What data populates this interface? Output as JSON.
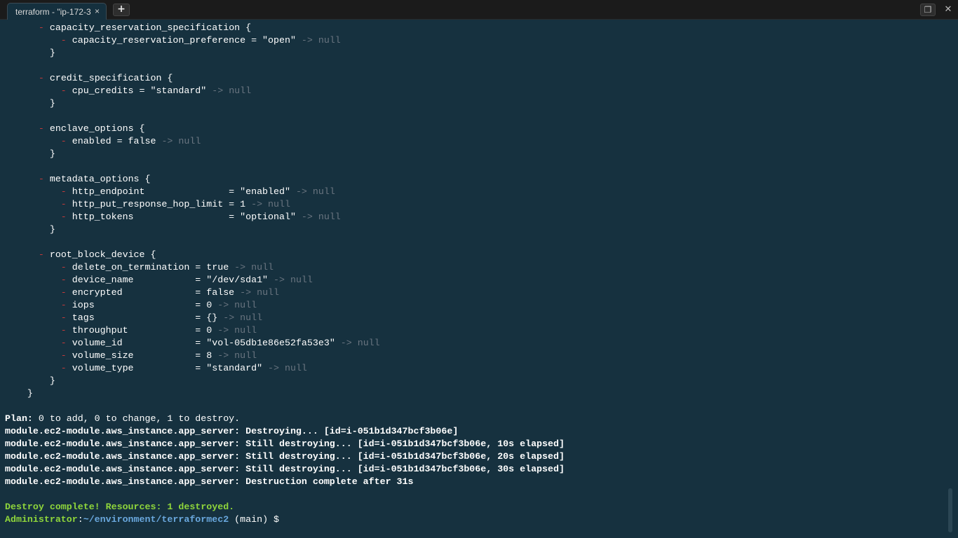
{
  "tab": {
    "title": "terraform - \"ip-172-3",
    "close_glyph": "×"
  },
  "new_tab_glyph": "+",
  "window": {
    "restore_glyph": "❐",
    "close_glyph": "✕"
  },
  "terminal": {
    "lines": [
      {
        "segs": [
          {
            "t": "      "
          },
          {
            "t": "-",
            "c": "minus"
          },
          {
            "t": " capacity_reservation_specification {"
          }
        ]
      },
      {
        "segs": [
          {
            "t": "          "
          },
          {
            "t": "-",
            "c": "minus"
          },
          {
            "t": " capacity_reservation_preference = \"open\" "
          },
          {
            "t": "-> null",
            "c": "null"
          }
        ]
      },
      {
        "segs": [
          {
            "t": "        }"
          }
        ]
      },
      {
        "segs": []
      },
      {
        "segs": [
          {
            "t": "      "
          },
          {
            "t": "-",
            "c": "minus"
          },
          {
            "t": " credit_specification {"
          }
        ]
      },
      {
        "segs": [
          {
            "t": "          "
          },
          {
            "t": "-",
            "c": "minus"
          },
          {
            "t": " cpu_credits = \"standard\" "
          },
          {
            "t": "-> null",
            "c": "null"
          }
        ]
      },
      {
        "segs": [
          {
            "t": "        }"
          }
        ]
      },
      {
        "segs": []
      },
      {
        "segs": [
          {
            "t": "      "
          },
          {
            "t": "-",
            "c": "minus"
          },
          {
            "t": " enclave_options {"
          }
        ]
      },
      {
        "segs": [
          {
            "t": "          "
          },
          {
            "t": "-",
            "c": "minus"
          },
          {
            "t": " enabled = false "
          },
          {
            "t": "-> null",
            "c": "null"
          }
        ]
      },
      {
        "segs": [
          {
            "t": "        }"
          }
        ]
      },
      {
        "segs": []
      },
      {
        "segs": [
          {
            "t": "      "
          },
          {
            "t": "-",
            "c": "minus"
          },
          {
            "t": " metadata_options {"
          }
        ]
      },
      {
        "segs": [
          {
            "t": "          "
          },
          {
            "t": "-",
            "c": "minus"
          },
          {
            "t": " http_endpoint               = \"enabled\" "
          },
          {
            "t": "-> null",
            "c": "null"
          }
        ]
      },
      {
        "segs": [
          {
            "t": "          "
          },
          {
            "t": "-",
            "c": "minus"
          },
          {
            "t": " http_put_response_hop_limit = 1 "
          },
          {
            "t": "-> null",
            "c": "null"
          }
        ]
      },
      {
        "segs": [
          {
            "t": "          "
          },
          {
            "t": "-",
            "c": "minus"
          },
          {
            "t": " http_tokens                 = \"optional\" "
          },
          {
            "t": "-> null",
            "c": "null"
          }
        ]
      },
      {
        "segs": [
          {
            "t": "        }"
          }
        ]
      },
      {
        "segs": []
      },
      {
        "segs": [
          {
            "t": "      "
          },
          {
            "t": "-",
            "c": "minus"
          },
          {
            "t": " root_block_device {"
          }
        ]
      },
      {
        "segs": [
          {
            "t": "          "
          },
          {
            "t": "-",
            "c": "minus"
          },
          {
            "t": " delete_on_termination = true "
          },
          {
            "t": "-> null",
            "c": "null"
          }
        ]
      },
      {
        "segs": [
          {
            "t": "          "
          },
          {
            "t": "-",
            "c": "minus"
          },
          {
            "t": " device_name           = \"/dev/sda1\" "
          },
          {
            "t": "-> null",
            "c": "null"
          }
        ]
      },
      {
        "segs": [
          {
            "t": "          "
          },
          {
            "t": "-",
            "c": "minus"
          },
          {
            "t": " encrypted             = false "
          },
          {
            "t": "-> null",
            "c": "null"
          }
        ]
      },
      {
        "segs": [
          {
            "t": "          "
          },
          {
            "t": "-",
            "c": "minus"
          },
          {
            "t": " iops                  = 0 "
          },
          {
            "t": "-> null",
            "c": "null"
          }
        ]
      },
      {
        "segs": [
          {
            "t": "          "
          },
          {
            "t": "-",
            "c": "minus"
          },
          {
            "t": " tags                  = {} "
          },
          {
            "t": "-> null",
            "c": "null"
          }
        ]
      },
      {
        "segs": [
          {
            "t": "          "
          },
          {
            "t": "-",
            "c": "minus"
          },
          {
            "t": " throughput            = 0 "
          },
          {
            "t": "-> null",
            "c": "null"
          }
        ]
      },
      {
        "segs": [
          {
            "t": "          "
          },
          {
            "t": "-",
            "c": "minus"
          },
          {
            "t": " volume_id             = \"vol-05db1e86e52fa53e3\" "
          },
          {
            "t": "-> null",
            "c": "null"
          }
        ]
      },
      {
        "segs": [
          {
            "t": "          "
          },
          {
            "t": "-",
            "c": "minus"
          },
          {
            "t": " volume_size           = 8 "
          },
          {
            "t": "-> null",
            "c": "null"
          }
        ]
      },
      {
        "segs": [
          {
            "t": "          "
          },
          {
            "t": "-",
            "c": "minus"
          },
          {
            "t": " volume_type           = \"standard\" "
          },
          {
            "t": "-> null",
            "c": "null"
          }
        ]
      },
      {
        "segs": [
          {
            "t": "        }"
          }
        ]
      },
      {
        "segs": [
          {
            "t": "    }"
          }
        ]
      },
      {
        "segs": []
      },
      {
        "segs": [
          {
            "t": "Plan:",
            "c": "bold"
          },
          {
            "t": " 0 to add, 0 to change, 1 to destroy."
          }
        ]
      },
      {
        "segs": [
          {
            "t": "module.ec2-module.aws_instance.app_server: Destroying... [id=i-051b1d347bcf3b06e]",
            "c": "bold"
          }
        ]
      },
      {
        "segs": [
          {
            "t": "module.ec2-module.aws_instance.app_server: Still destroying... [id=i-051b1d347bcf3b06e, 10s elapsed]",
            "c": "bold"
          }
        ]
      },
      {
        "segs": [
          {
            "t": "module.ec2-module.aws_instance.app_server: Still destroying... [id=i-051b1d347bcf3b06e, 20s elapsed]",
            "c": "bold"
          }
        ]
      },
      {
        "segs": [
          {
            "t": "module.ec2-module.aws_instance.app_server: Still destroying... [id=i-051b1d347bcf3b06e, 30s elapsed]",
            "c": "bold"
          }
        ]
      },
      {
        "segs": [
          {
            "t": "module.ec2-module.aws_instance.app_server: Destruction complete after 31s",
            "c": "bold"
          }
        ]
      },
      {
        "segs": []
      },
      {
        "segs": [
          {
            "t": "Destroy complete! Resources: 1 destroyed.",
            "c": "green"
          }
        ]
      },
      {
        "segs": [
          {
            "t": "Administrator",
            "c": "green"
          },
          {
            "t": ":"
          },
          {
            "t": "~/environment/terraformec2",
            "c": "blue"
          },
          {
            "t": " (main) $ "
          }
        ]
      }
    ]
  }
}
